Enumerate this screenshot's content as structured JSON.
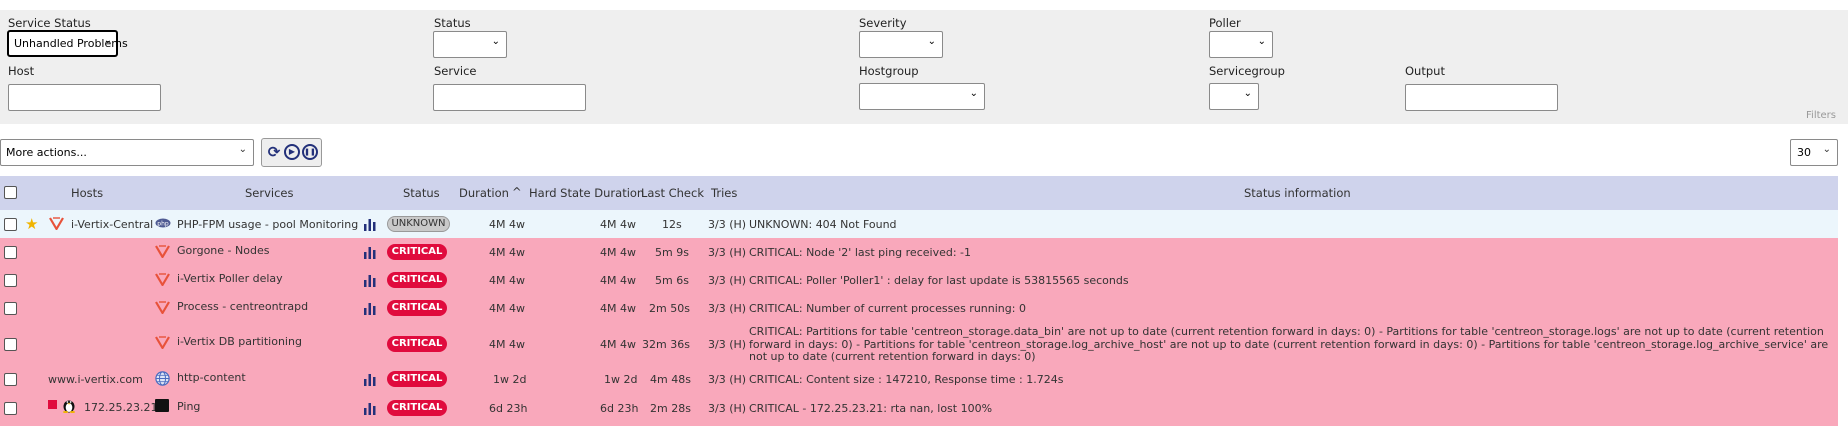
{
  "filters": {
    "service_status": {
      "label": "Service Status",
      "value": "Unhandled Problems"
    },
    "status": {
      "label": "Status",
      "value": ""
    },
    "severity": {
      "label": "Severity",
      "value": ""
    },
    "poller": {
      "label": "Poller",
      "value": ""
    },
    "host": {
      "label": "Host",
      "value": ""
    },
    "service": {
      "label": "Service",
      "value": ""
    },
    "hostgroup": {
      "label": "Hostgroup",
      "value": ""
    },
    "servicegroup": {
      "label": "Servicegroup",
      "value": ""
    },
    "output": {
      "label": "Output",
      "value": ""
    },
    "filters_link": "Filters"
  },
  "toolbar": {
    "more_actions": "More actions...",
    "page_size": "30",
    "refresh_icon": "refresh-icon",
    "play_icon": "play-icon",
    "pause_icon": "pause-icon"
  },
  "table": {
    "headers": {
      "hosts": "Hosts",
      "services": "Services",
      "status": "Status",
      "duration": "Duration",
      "hard_state_duration": "Hard State Duration",
      "last_check": "Last Check",
      "tries": "Tries",
      "status_information": "Status information",
      "sort_icon": "sort-ascending-icon"
    },
    "rows": [
      {
        "host": "i-Vertix-Central",
        "service": "PHP-FPM usage - pool Monitoring",
        "status": "UNKNOWN",
        "duration": "4M 4w",
        "hard_duration": "4M 4w",
        "last_check": "12s",
        "tries": "3/3 (H)",
        "info": "UNKNOWN: 404 Not Found"
      },
      {
        "host": "",
        "service": "Gorgone - Nodes",
        "status": "CRITICAL",
        "duration": "4M 4w",
        "hard_duration": "4M 4w",
        "last_check": "5m 9s",
        "tries": "3/3 (H)",
        "info": "CRITICAL: Node '2' last ping received: -1"
      },
      {
        "host": "",
        "service": "i-Vertix Poller delay",
        "status": "CRITICAL",
        "duration": "4M 4w",
        "hard_duration": "4M 4w",
        "last_check": "5m 6s",
        "tries": "3/3 (H)",
        "info": "CRITICAL: Poller 'Poller1' : delay for last update is 53815565 seconds"
      },
      {
        "host": "",
        "service": "Process - centreontrapd",
        "status": "CRITICAL",
        "duration": "4M 4w",
        "hard_duration": "4M 4w",
        "last_check": "2m 50s",
        "tries": "3/3 (H)",
        "info": "CRITICAL: Number of current processes running: 0"
      },
      {
        "host": "",
        "service": "i-Vertix DB partitioning",
        "status": "CRITICAL",
        "duration": "4M 4w",
        "hard_duration": "4M 4w",
        "last_check": "32m 36s",
        "tries": "3/3 (H)",
        "info": "CRITICAL: Partitions for table 'centreon_storage.data_bin' are not up to date (current retention forward in days: 0) - Partitions for table 'centreon_storage.logs' are not up to date (current retention forward in days: 0) - Partitions for table 'centreon_storage.log_archive_host' are not up to date (current retention forward in days: 0) - Partitions for table 'centreon_storage.log_archive_service' are not up to date (current retention forward in days: 0)"
      },
      {
        "host": "www.i-vertix.com",
        "service": "http-content",
        "status": "CRITICAL",
        "duration": "1w 2d",
        "hard_duration": "1w 2d",
        "last_check": "4m 48s",
        "tries": "3/3 (H)",
        "info": "CRITICAL: Content size : 147210, Response time : 1.724s"
      },
      {
        "host": "172.25.23.21",
        "service": "Ping",
        "status": "CRITICAL",
        "duration": "6d 23h",
        "hard_duration": "6d 23h",
        "last_check": "2m 28s",
        "tries": "3/3 (H)",
        "info": "CRITICAL - 172.25.23.21: rta nan, lost 100%"
      }
    ]
  },
  "icons": {
    "favorite": "star-icon",
    "vertix_logo": "i-vertix-logo-icon",
    "php": "php-icon",
    "globe": "globe-icon",
    "linux": "linux-penguin-icon",
    "terminal": "terminal-icon",
    "graph": "bar-chart-icon"
  },
  "colors": {
    "critical_row": "#f9a8bb",
    "critical_badge": "#e00b3d",
    "unknown_row": "#ecf6fc",
    "header_bg": "#cfd3ec",
    "accent": "#23307a"
  }
}
